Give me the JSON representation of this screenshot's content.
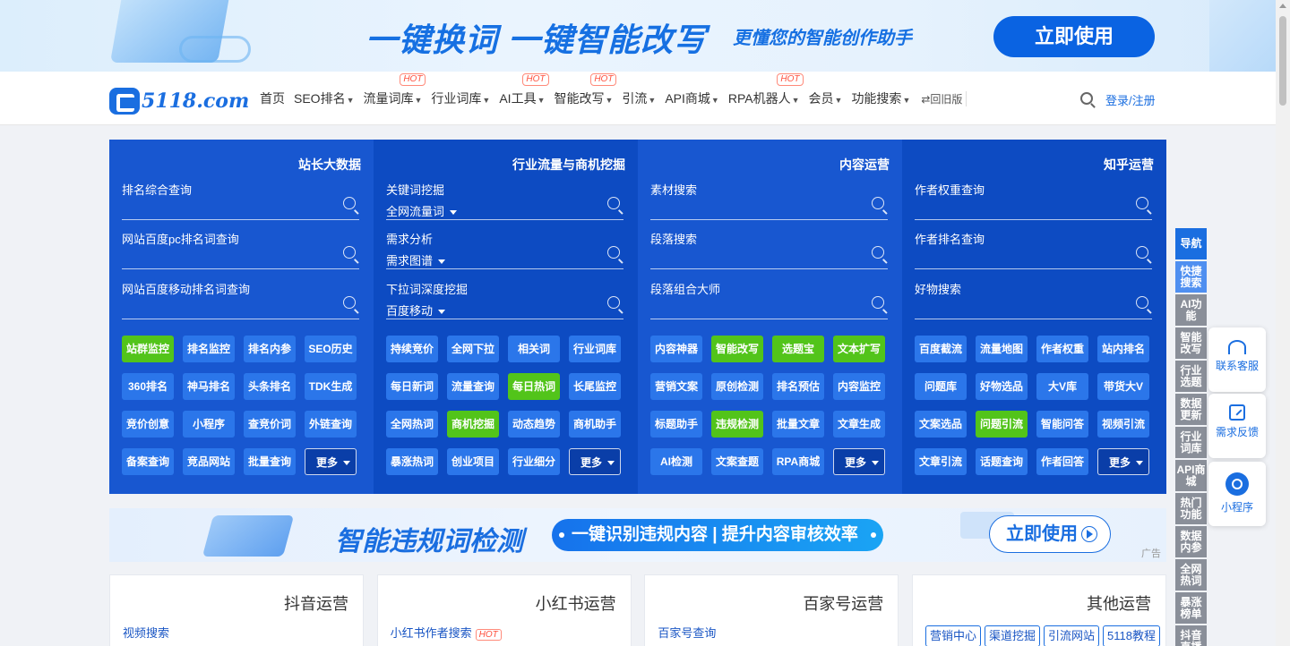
{
  "banner": {
    "headline": "一键换词 一键智能改写",
    "subline": "更懂您的智能创作助手",
    "cta": "立即使用"
  },
  "nav": {
    "logo": "5118.com",
    "items": [
      {
        "label": "首页",
        "caret": false,
        "hot": false
      },
      {
        "label": "SEO排名",
        "caret": true,
        "hot": false
      },
      {
        "label": "流量词库",
        "caret": true,
        "hot": true
      },
      {
        "label": "行业词库",
        "caret": true,
        "hot": false
      },
      {
        "label": "AI工具",
        "caret": true,
        "hot": true
      },
      {
        "label": "智能改写",
        "caret": true,
        "hot": true
      },
      {
        "label": "引流",
        "caret": true,
        "hot": false
      },
      {
        "label": "API商城",
        "caret": true,
        "hot": false
      },
      {
        "label": "RPA机器人",
        "caret": true,
        "hot": true
      },
      {
        "label": "会员",
        "caret": true,
        "hot": false
      },
      {
        "label": "功能搜索",
        "caret": true,
        "hot": false
      }
    ],
    "hot_label": "HOT",
    "old_version": "⇄回旧版",
    "login": "登录/注册"
  },
  "panels": [
    {
      "title": "站长大数据",
      "searches": [
        {
          "label": "排名综合查询",
          "select": ""
        },
        {
          "label": "网站百度pc排名词查询",
          "select": ""
        },
        {
          "label": "网站百度移动排名词查询",
          "select": ""
        }
      ],
      "tags": [
        {
          "label": "站群监控",
          "green": true
        },
        {
          "label": "排名监控",
          "green": false
        },
        {
          "label": "排名内参",
          "green": false
        },
        {
          "label": "SEO历史",
          "green": false
        },
        {
          "label": "360排名",
          "green": false
        },
        {
          "label": "神马排名",
          "green": false
        },
        {
          "label": "头条排名",
          "green": false
        },
        {
          "label": "TDK生成",
          "green": false
        },
        {
          "label": "竞价创意",
          "green": false
        },
        {
          "label": "小程序",
          "green": false
        },
        {
          "label": "查竞价词",
          "green": false
        },
        {
          "label": "外链查询",
          "green": false
        },
        {
          "label": "备案查询",
          "green": false
        },
        {
          "label": "竞品网站",
          "green": false
        },
        {
          "label": "批量查询",
          "green": false
        }
      ],
      "more": "更多"
    },
    {
      "title": "行业流量与商机挖掘",
      "searches": [
        {
          "label": "关键词挖掘",
          "select": "全网流量词"
        },
        {
          "label": "需求分析",
          "select": "需求图谱"
        },
        {
          "label": "下拉词深度挖掘",
          "select": "百度移动"
        }
      ],
      "tags": [
        {
          "label": "持续竞价",
          "green": false
        },
        {
          "label": "全网下拉",
          "green": false
        },
        {
          "label": "相关词",
          "green": false
        },
        {
          "label": "行业词库",
          "green": false
        },
        {
          "label": "每日新词",
          "green": false
        },
        {
          "label": "流量查询",
          "green": false
        },
        {
          "label": "每日热词",
          "green": true
        },
        {
          "label": "长尾监控",
          "green": false
        },
        {
          "label": "全网热词",
          "green": false
        },
        {
          "label": "商机挖掘",
          "green": true
        },
        {
          "label": "动态趋势",
          "green": false
        },
        {
          "label": "商机助手",
          "green": false
        },
        {
          "label": "暴涨热词",
          "green": false
        },
        {
          "label": "创业项目",
          "green": false
        },
        {
          "label": "行业细分",
          "green": false
        }
      ],
      "more": "更多"
    },
    {
      "title": "内容运营",
      "searches": [
        {
          "label": "素材搜索",
          "select": ""
        },
        {
          "label": "段落搜索",
          "select": ""
        },
        {
          "label": "段落组合大师",
          "select": ""
        }
      ],
      "tags": [
        {
          "label": "内容神器",
          "green": false
        },
        {
          "label": "智能改写",
          "green": true
        },
        {
          "label": "选题宝",
          "green": true
        },
        {
          "label": "文本扩写",
          "green": true
        },
        {
          "label": "营销文案",
          "green": false
        },
        {
          "label": "原创检测",
          "green": false
        },
        {
          "label": "排名预估",
          "green": false
        },
        {
          "label": "内容监控",
          "green": false
        },
        {
          "label": "标题助手",
          "green": false
        },
        {
          "label": "违规检测",
          "green": true
        },
        {
          "label": "批量文章",
          "green": false
        },
        {
          "label": "文章生成",
          "green": false
        },
        {
          "label": "AI检测",
          "green": false
        },
        {
          "label": "文案查题",
          "green": false
        },
        {
          "label": "RPA商城",
          "green": false
        }
      ],
      "more": "更多"
    },
    {
      "title": "知乎运营",
      "searches": [
        {
          "label": "作者权重查询",
          "select": ""
        },
        {
          "label": "作者排名查询",
          "select": ""
        },
        {
          "label": "好物搜索",
          "select": ""
        }
      ],
      "tags": [
        {
          "label": "百度截流",
          "green": false
        },
        {
          "label": "流量地图",
          "green": false
        },
        {
          "label": "作者权重",
          "green": false
        },
        {
          "label": "站内排名",
          "green": false
        },
        {
          "label": "问题库",
          "green": false
        },
        {
          "label": "好物选品",
          "green": false
        },
        {
          "label": "大V库",
          "green": false
        },
        {
          "label": "带货大V",
          "green": false
        },
        {
          "label": "文案选品",
          "green": false
        },
        {
          "label": "问题引流",
          "green": true
        },
        {
          "label": "智能问答",
          "green": false
        },
        {
          "label": "视频引流",
          "green": false
        },
        {
          "label": "文章引流",
          "green": false
        },
        {
          "label": "话题查询",
          "green": false
        },
        {
          "label": "作者回答",
          "green": false
        }
      ],
      "more": "更多"
    }
  ],
  "ad": {
    "title": "智能违规词检测",
    "pill": "一键识别违规内容 | 提升内容审核效率",
    "button": "立即使用",
    "mark": "广告"
  },
  "cards": [
    {
      "title": "抖音运营",
      "link": "视频搜索",
      "hot": false
    },
    {
      "title": "小红书运营",
      "link": "小红书作者搜索",
      "hot": true
    },
    {
      "title": "百家号运营",
      "link": "百家号查询",
      "hot": false
    },
    {
      "title": "其他运营",
      "link": "",
      "hot": false
    }
  ],
  "other_pills": [
    "营销中心",
    "渠道挖掘",
    "引流网站",
    "5118教程"
  ],
  "side_tabs": [
    "导航",
    "快捷搜索",
    "AI功能",
    "智能改写",
    "行业选题",
    "数据更新",
    "行业词库",
    "API商城",
    "热门功能",
    "数据内参",
    "全网热词",
    "暴涨榜单",
    "抖音直播"
  ],
  "floats": [
    {
      "label": "联系客服",
      "icon": "headset-icon"
    },
    {
      "label": "需求反馈",
      "icon": "edit-icon"
    },
    {
      "label": "小程序",
      "icon": "mini-program-icon"
    }
  ]
}
